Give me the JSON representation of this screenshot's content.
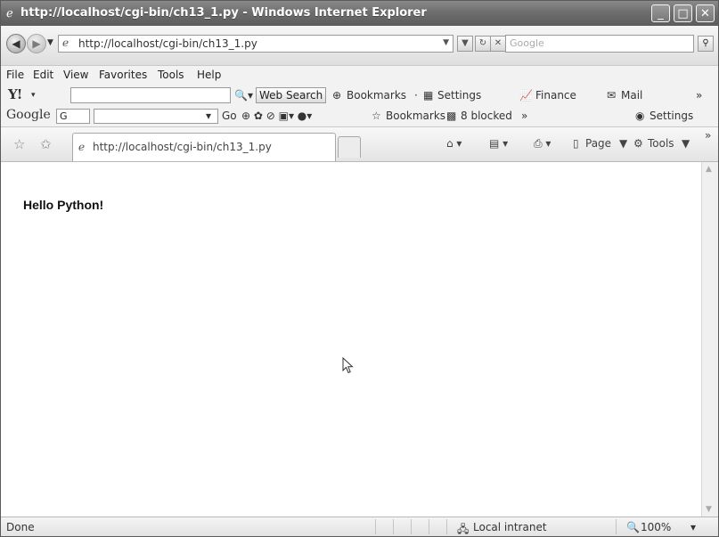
{
  "window": {
    "title": "http://localhost/cgi-bin/ch13_1.py - Windows Internet Explorer",
    "minimize_glyph": "_",
    "maximize_glyph": "□",
    "close_glyph": "✕"
  },
  "address_bar": {
    "url": "http://localhost/cgi-bin/ch13_1.py",
    "search_placeholder": "Google"
  },
  "menu": [
    "File",
    "Edit",
    "View",
    "Favorites",
    "Tools",
    "Help"
  ],
  "yahoo_toolbar": {
    "logo": "Y!",
    "web_search_label": "Web Search",
    "bookmarks_label": "Bookmarks",
    "settings_label": "Settings",
    "finance_label": "Finance",
    "mail_label": "Mail",
    "overflow": "»"
  },
  "google_toolbar": {
    "logo": "Google",
    "g_label": "G",
    "go_label": "Go",
    "bookmarks_label": "Bookmarks",
    "blocked_label": "8 blocked",
    "overflow": "»",
    "settings_label": "Settings"
  },
  "tab": {
    "label": "http://localhost/cgi-bin/ch13_1.py"
  },
  "command_bar": {
    "page_label": "Page",
    "tools_label": "Tools",
    "overflow": "»"
  },
  "content": {
    "text": "Hello Python!"
  },
  "status_bar": {
    "status": "Done",
    "zone": "Local intranet",
    "zoom": "100%"
  }
}
